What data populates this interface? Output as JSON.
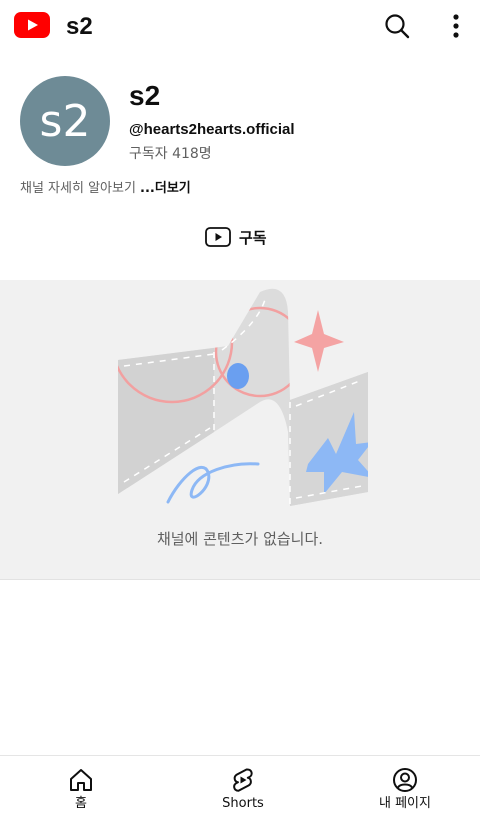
{
  "header": {
    "title": "s2",
    "logo_icon": "youtube-logo-icon",
    "search_icon": "search-icon",
    "more_icon": "more-vertical-icon",
    "brand_color": "#ff0000"
  },
  "channel": {
    "avatar_text": "s2",
    "avatar_color": "#6e8b96",
    "name": "s2",
    "handle": "@hearts2hearts.official",
    "subscribers": "구독자 418명",
    "about_text": "채널 자세히 알아보기 ",
    "about_more": "...더보기",
    "subscribe_label": "구독",
    "subscribe_icon": "play-outline-icon"
  },
  "empty_state": {
    "message": "채널에 콘텐츠가 없습니다."
  },
  "bottom_nav": {
    "items": [
      {
        "label": "홈",
        "icon": "home-icon"
      },
      {
        "label": "Shorts",
        "icon": "shorts-icon"
      },
      {
        "label": "내 페이지",
        "icon": "account-circle-icon"
      }
    ]
  }
}
